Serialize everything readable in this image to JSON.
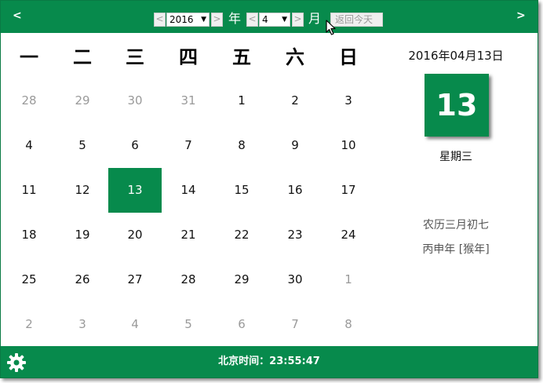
{
  "header": {
    "prev_arrow": "<",
    "next_arrow": ">",
    "year_dec": "<",
    "year_value": "2016",
    "year_inc": ">",
    "year_unit": "年",
    "month_dec": "<",
    "month_value": "4",
    "month_inc": ">",
    "month_unit": "月",
    "today_button": "返回今天",
    "select_caret": "▼"
  },
  "weekdays": [
    "一",
    "二",
    "三",
    "四",
    "五",
    "六",
    "日"
  ],
  "weeks": [
    [
      {
        "d": "28",
        "other": true
      },
      {
        "d": "29",
        "other": true
      },
      {
        "d": "30",
        "other": true
      },
      {
        "d": "31",
        "other": true
      },
      {
        "d": "1",
        "other": false
      },
      {
        "d": "2",
        "other": false
      },
      {
        "d": "3",
        "other": false
      }
    ],
    [
      {
        "d": "4",
        "other": false
      },
      {
        "d": "5",
        "other": false
      },
      {
        "d": "6",
        "other": false
      },
      {
        "d": "7",
        "other": false
      },
      {
        "d": "8",
        "other": false
      },
      {
        "d": "9",
        "other": false
      },
      {
        "d": "10",
        "other": false
      }
    ],
    [
      {
        "d": "11",
        "other": false
      },
      {
        "d": "12",
        "other": false
      },
      {
        "d": "13",
        "other": false,
        "selected": true
      },
      {
        "d": "14",
        "other": false
      },
      {
        "d": "15",
        "other": false
      },
      {
        "d": "16",
        "other": false
      },
      {
        "d": "17",
        "other": false
      }
    ],
    [
      {
        "d": "18",
        "other": false
      },
      {
        "d": "19",
        "other": false
      },
      {
        "d": "20",
        "other": false
      },
      {
        "d": "21",
        "other": false
      },
      {
        "d": "22",
        "other": false
      },
      {
        "d": "23",
        "other": false
      },
      {
        "d": "24",
        "other": false
      }
    ],
    [
      {
        "d": "25",
        "other": false
      },
      {
        "d": "26",
        "other": false
      },
      {
        "d": "27",
        "other": false
      },
      {
        "d": "28",
        "other": false
      },
      {
        "d": "29",
        "other": false
      },
      {
        "d": "30",
        "other": false
      },
      {
        "d": "1",
        "other": true
      }
    ],
    [
      {
        "d": "2",
        "other": true
      },
      {
        "d": "3",
        "other": true
      },
      {
        "d": "4",
        "other": true
      },
      {
        "d": "5",
        "other": true
      },
      {
        "d": "6",
        "other": true
      },
      {
        "d": "7",
        "other": true
      },
      {
        "d": "8",
        "other": true
      }
    ]
  ],
  "side": {
    "full_date": "2016年04月13日",
    "big_day": "13",
    "weekday_name": "星期三",
    "lunar": "农历三月初七",
    "ganzhi": "丙申年 [猴年]"
  },
  "footer": {
    "clock": "北京时间：23:55:47"
  },
  "colors": {
    "accent": "#078a4c",
    "muted_day": "#9a9a9a"
  },
  "icons": {
    "settings": "gear-icon",
    "cursor": "mouse-pointer-icon"
  }
}
